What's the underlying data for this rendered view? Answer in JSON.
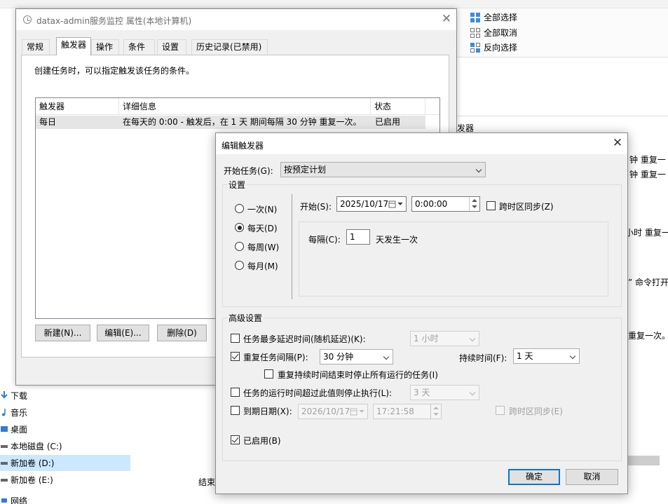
{
  "explorer": {
    "ribbon": {
      "select_all": "全部选择",
      "select_none": "全部取消",
      "invert_selection": "反向选择"
    },
    "sidebar": [
      {
        "label": "下载",
        "icon": "download-arrow-icon"
      },
      {
        "label": "音乐",
        "icon": "music-note-icon"
      },
      {
        "label": "桌面",
        "icon": "desktop-icon"
      },
      {
        "label": "本地磁盘 (C:)",
        "icon": "drive-icon"
      },
      {
        "label": "新加卷 (D:)",
        "icon": "drive-icon"
      },
      {
        "label": "新加卷 (E:)",
        "icon": "drive-icon"
      },
      {
        "label": "网络",
        "icon": "network-icon"
      }
    ],
    "right_fragments": {
      "triggers_header": "发器",
      "repeat_1": "钟 重复一",
      "repeat_2": "钟 重复一",
      "repeat_3": "小时 重复一",
      "command": "” 命令打开",
      "repeat_once": "重复一次。",
      "status_end": "结束"
    }
  },
  "properties": {
    "title": "datax-admin服务监控 属性(本地计算机)",
    "tabs": [
      "常规",
      "触发器",
      "操作",
      "条件",
      "设置",
      "历史记录(已禁用)"
    ],
    "active_tab": "触发器",
    "description": "创建任务时，可以指定触发该任务的条件。",
    "list_headers": [
      "触发器",
      "详细信息",
      "状态"
    ],
    "rows": [
      {
        "trigger": "每日",
        "details": "在每天的 0:00 - 触发后，在 1 天 期间每隔 30 分钟 重复一次。",
        "status": "已启用"
      }
    ],
    "buttons": {
      "new": "新建(N)...",
      "edit": "编辑(E)...",
      "delete": "删除(D)"
    }
  },
  "dialog": {
    "title": "编辑触发器",
    "begin_task_label": "开始任务(G):",
    "begin_task_value": "按预定计划",
    "settings_label": "设置",
    "schedule_options": [
      "一次(N)",
      "每天(D)",
      "每周(W)",
      "每月(M)"
    ],
    "selected_schedule": "每天(D)",
    "start_label": "开始(S):",
    "start_date": "2025/10/17",
    "start_time": "0:00:00",
    "sync_timezone": "跨时区同步(Z)",
    "recur_label": "每隔(C):",
    "recur_value": "1",
    "recur_suffix": "天发生一次",
    "advanced_label": "高级设置",
    "delay_label": "任务最多延迟时间(随机延迟)(K):",
    "delay_value": "1 小时",
    "repeat_label": "重复任务间隔(P):",
    "repeat_value": "30 分钟",
    "duration_label": "持续时间(F):",
    "duration_value": "1 天",
    "stop_at_end_label": "重复持续时间结束时停止所有运行的任务(I)",
    "stop_if_longer_label": "任务的运行时间超过此值则停止执行(L):",
    "stop_if_longer_value": "3 天",
    "expire_label": "到期日期(X):",
    "expire_date": "2026/10/17",
    "expire_time": "17:21:58",
    "expire_sync": "跨时区同步(E)",
    "enabled_label": "已启用(B)",
    "ok": "确定",
    "cancel": "取消",
    "checked": {
      "delay": false,
      "repeat": true,
      "stop_at_end": false,
      "stop_if_longer": false,
      "expire": false,
      "enabled": true,
      "sync_timezone": false,
      "expire_sync": false
    }
  }
}
